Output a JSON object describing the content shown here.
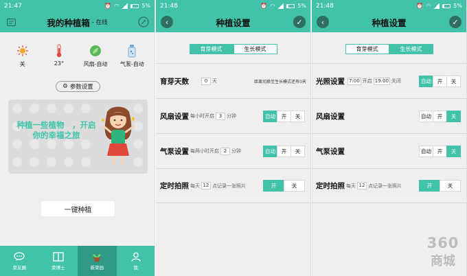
{
  "panel1": {
    "time": "21:47",
    "battery": "5%",
    "title": "我的种植箱",
    "subtitle": "- 在线",
    "status": [
      {
        "icon": "light-icon",
        "label": "关"
      },
      {
        "icon": "thermometer-icon",
        "label": "23°"
      },
      {
        "icon": "leaf-fan-icon",
        "label": "风扇-自动"
      },
      {
        "icon": "pump-bottle-icon",
        "label": "气泵-自动"
      }
    ],
    "param_button": "参数设置",
    "garden_text": "种植一些植物　，开启你的幸福之旅",
    "onekey_button": "一键种植",
    "tabs": [
      {
        "label": "菜友圈",
        "icon": "chat-icon"
      },
      {
        "label": "菜博士",
        "icon": "book-icon"
      },
      {
        "label": "新菜园",
        "icon": "plant-pot-icon"
      },
      {
        "label": "我",
        "icon": "person-icon"
      }
    ]
  },
  "panel2": {
    "time": "21:48",
    "battery": "5%",
    "title": "种植设置",
    "mode_tabs": [
      "育芽模式",
      "生长模式"
    ],
    "rows": {
      "sprout": {
        "label": "育芽天数",
        "value": "0",
        "unit": "天",
        "hint_pre": "距离切换至生长模式还有",
        "hint_val": "0",
        "hint_unit": "天"
      },
      "fan": {
        "label": "风扇设置",
        "pre": "每小时开启",
        "value": "3",
        "unit": "分钟",
        "options": [
          "自动",
          "开",
          "关"
        ]
      },
      "pump": {
        "label": "气泵设置",
        "pre": "每两小时开启",
        "value": "2",
        "unit": "分钟",
        "options": [
          "自动",
          "开",
          "关"
        ]
      },
      "photo": {
        "label": "定时拍照",
        "pre": "每天",
        "value": "12",
        "unit": "点记录一张照片",
        "options": [
          "开",
          "关"
        ]
      }
    }
  },
  "panel3": {
    "time": "21:48",
    "battery": "5%",
    "title": "种植设置",
    "mode_tabs": [
      "育芽模式",
      "生长模式"
    ],
    "rows": {
      "light": {
        "label": "光照设置",
        "start": "7:00",
        "start_word": "开启",
        "end": "19:00",
        "end_word": "关闭",
        "options": [
          "自动",
          "开",
          "关"
        ]
      },
      "fan": {
        "label": "风扇设置",
        "options": [
          "自动",
          "开",
          "关"
        ]
      },
      "pump": {
        "label": "气泵设置",
        "options": [
          "自动",
          "开",
          "关"
        ]
      },
      "photo": {
        "label": "定时拍照",
        "pre": "每天",
        "value": "12",
        "unit": "点记录一张照片",
        "options": [
          "开",
          "关"
        ]
      }
    },
    "watermark": {
      "line1": "360",
      "line2": "商城"
    }
  },
  "colors": {
    "accent": "#41c2a9",
    "accent_dark": "#2f9b86",
    "bg": "#efefef"
  }
}
